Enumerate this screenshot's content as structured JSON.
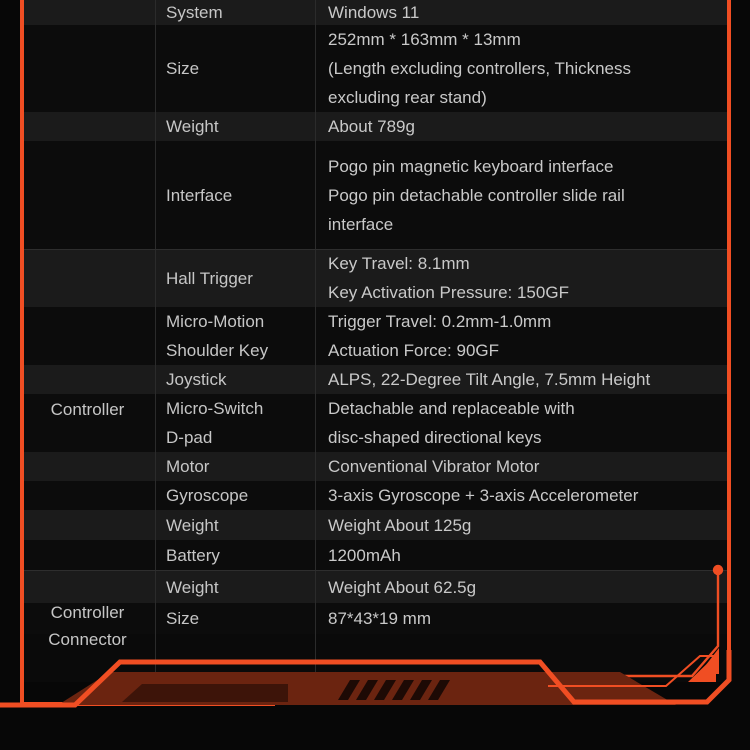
{
  "theme": {
    "background": "#070707",
    "accent": "#f04e23",
    "accent_fill": "#6b2410",
    "row_odd": "#1b1b1b",
    "row_even": "#0c0c0c",
    "text": "#c6c6c6",
    "grid": "#2b2b2b"
  },
  "spec_table": {
    "groups": [
      {
        "name": "",
        "rows": [
          0,
          1,
          2,
          3
        ]
      },
      {
        "name": "Controller",
        "rows": [
          4,
          5,
          6,
          7,
          8,
          9,
          10
        ]
      },
      {
        "name": "Controller\nConnector",
        "rows": [
          11,
          12,
          13
        ]
      }
    ],
    "rows": [
      {
        "group": "",
        "label": "System",
        "value": "Windows 11"
      },
      {
        "group": "",
        "label": "Size",
        "value": "252mm * 163mm * 13mm\n(Length excluding controllers, Thickness\nexcluding rear stand)"
      },
      {
        "group": "",
        "label": "Weight",
        "value": "About 789g"
      },
      {
        "group": "",
        "label": "Interface",
        "value": "Pogo pin magnetic keyboard interface\nPogo pin detachable controller slide rail\ninterface"
      },
      {
        "group": "Controller",
        "label": "Hall Trigger",
        "value": "Key Travel: 8.1mm\nKey Activation Pressure: 150GF"
      },
      {
        "group": "Controller",
        "label": "Micro-Motion\nShoulder Key",
        "value": "Trigger Travel: 0.2mm-1.0mm\nActuation Force: 90GF"
      },
      {
        "group": "Controller",
        "label": "Joystick",
        "value": "ALPS, 22-Degree Tilt Angle, 7.5mm Height"
      },
      {
        "group": "Controller",
        "label": "Micro-Switch\nD-pad",
        "value": "Detachable and replaceable with\ndisc-shaped directional keys"
      },
      {
        "group": "Controller",
        "label": "Motor",
        "value": "Conventional Vibrator Motor"
      },
      {
        "group": "Controller",
        "label": "Gyroscope",
        "value": "3-axis Gyroscope + 3-axis Accelerometer"
      },
      {
        "group": "Controller",
        "label": "Weight",
        "value": "Weight About 125g"
      },
      {
        "group": "Controller Connector",
        "label": "Battery",
        "value": "1200mAh"
      },
      {
        "group": "Controller Connector",
        "label": "Weight",
        "value": "Weight About 62.5g"
      },
      {
        "group": "Controller Connector",
        "label": "Size",
        "value": "87*43*19 mm"
      }
    ]
  },
  "decoration": {
    "bottom_graphic": "angular-device-silhouette",
    "vent_slashes": 6,
    "connector_dot": "node-dot",
    "corner_arrow": "triangle-arrow"
  }
}
